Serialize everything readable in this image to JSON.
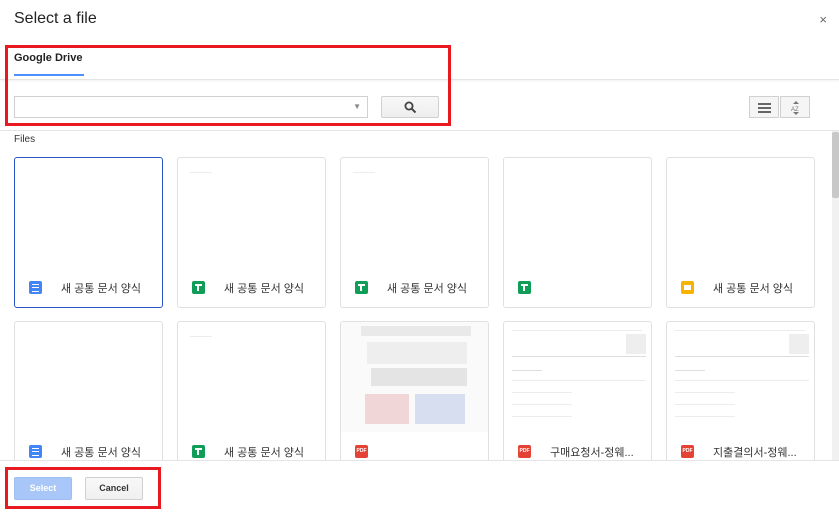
{
  "dialog": {
    "title": "Select a file",
    "close_symbol": "×"
  },
  "tabs": [
    {
      "label": "Google Drive",
      "active": true
    }
  ],
  "search": {
    "value": "",
    "placeholder": ""
  },
  "section_label": "Files",
  "files": [
    {
      "name": "새 공통 문서 양식",
      "type": "doc",
      "selected": true,
      "preview": "blank"
    },
    {
      "name": "새 공통 문서 양식",
      "type": "sheet",
      "selected": false,
      "preview": "blank"
    },
    {
      "name": "새 공통 문서 양식",
      "type": "sheet",
      "selected": false,
      "preview": "blank"
    },
    {
      "name": "",
      "type": "sheet",
      "selected": false,
      "preview": "blank",
      "name_blurred": true
    },
    {
      "name": "새 공통 문서 양식",
      "type": "slide",
      "selected": false,
      "preview": "blank"
    },
    {
      "name": "새 공통 문서 양식",
      "type": "doc",
      "selected": false,
      "preview": "blank"
    },
    {
      "name": "새 공통 문서 양식",
      "type": "sheet",
      "selected": false,
      "preview": "blank"
    },
    {
      "name": "",
      "type": "pdf",
      "selected": false,
      "preview": "blurred-pdf",
      "name_blurred": true
    },
    {
      "name": "구매요청서-정웨...",
      "type": "pdf",
      "selected": false,
      "preview": "form"
    },
    {
      "name": "지출결의서-정웨...",
      "type": "pdf",
      "selected": false,
      "preview": "form"
    }
  ],
  "icons": {
    "pdf_label": "PDF"
  },
  "footer": {
    "select_label": "Select",
    "cancel_label": "Cancel"
  },
  "colors": {
    "accent": "#4d90fe",
    "highlight_box": "#e8191f",
    "doc": "#4285f4",
    "sheet": "#0f9d58",
    "slide": "#f4b400",
    "pdf": "#e34234"
  }
}
